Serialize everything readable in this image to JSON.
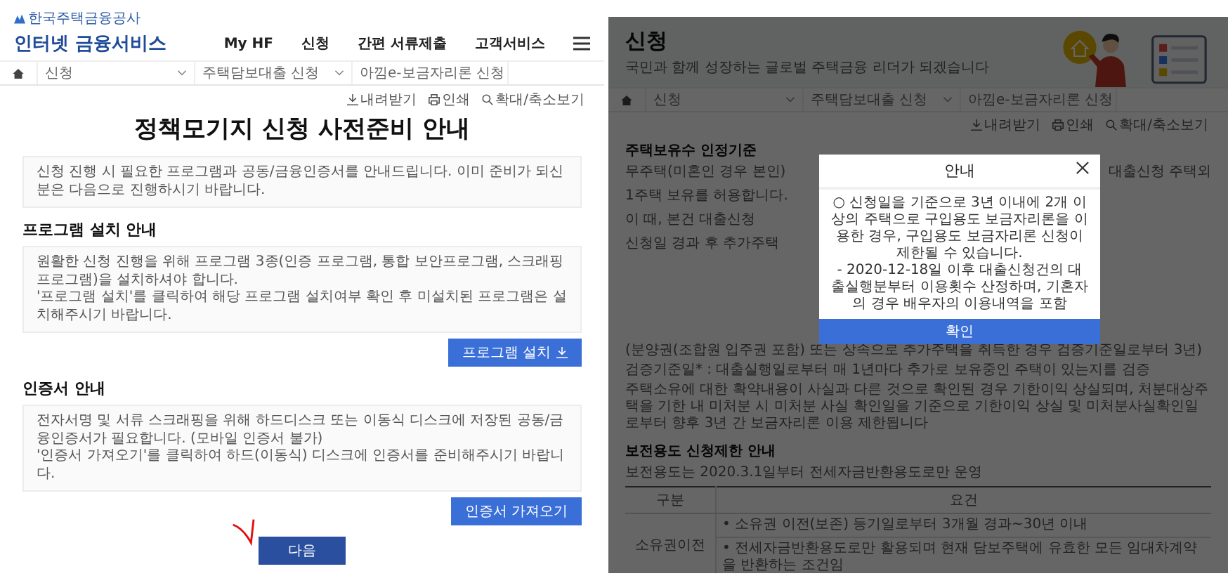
{
  "left_page": {
    "header": {
      "org_name": "한국주택금융공사",
      "service_name": "인터넷 금융서비스",
      "nav": [
        "My HF",
        "신청",
        "간편 서류제출",
        "고객서비스"
      ]
    },
    "breadcrumb": [
      "신청",
      "주택담보대출 신청",
      "아낌e-보금자리론 신청"
    ],
    "tools": [
      "내려받기",
      "인쇄",
      "확대/축소보기"
    ],
    "title": "정책모기지 신청 사전준비 안내",
    "intro": "신청 진행 시 필요한 프로그램과 공동/금융인증서를 안내드립니다. 이미 준비가 되신 분은 다음으로 진행하시기 바랍니다.",
    "sections": [
      {
        "heading": "프로그램 설치 안내",
        "lines": [
          "원활한 신청 진행을 위해 프로그램 3종(인증 프로그램, 통합 보안프로그램, 스크래핑 프로그램)을 설치하셔야 합니다.",
          "'프로그램 설치'를 클릭하여 해당 프로그램 설치여부 확인 후 미설치된 프로그램은 설치해주시기 바랍니다."
        ],
        "button": "프로그램 설치"
      },
      {
        "heading": "인증서 안내",
        "lines": [
          "전자서명 및 서류 스크래핑을 위해 하드디스크 또는 이동식 디스크에 저장된 공동/금융인증서가 필요합니다. (모바일 인증서 불가)",
          "'인증서 가져오기'를 클릭하여 하드(이동식) 디스크에 인증서를 준비해주시기 바랍니다."
        ],
        "button": "인증서 가져오기"
      }
    ],
    "next_button": "다음"
  },
  "right_page": {
    "banner": {
      "title": "신청",
      "subtitle": "국민과 함께 성장하는 글로벌 주택금융 리더가 되겠습니다"
    },
    "breadcrumb": [
      "신청",
      "주택담보대출 신청",
      "아낌e-보금자리론 신청"
    ],
    "tools": [
      "내려받기",
      "인쇄",
      "확대/축소보기"
    ],
    "criteria": {
      "heading": "주택보유수 인정기준",
      "partial_lines": [
        {
          "left": "무주택(미혼인 경우 본인)",
          "right": "대출신청 주택외"
        },
        {
          "left": "1주택 보유를 허용합니다."
        },
        {
          "left": "이 때, 본건 대출신청"
        },
        {
          "left": "신청일 경과 후 추가주택"
        }
      ],
      "lines": [
        "(분양권(조합원 입주권 포함) 또는 상속으로 추가주택을 취득한 경우 검증기준일로부터 3년)",
        "검증기준일* : 대출실행일로부터 매 1년마다 추가로 보유중인 주택이 있는지를 검증",
        "주택소유에 대한 확약내용이 사실과 다른 것으로 확인된 경우 기한이익 상실되며, 처분대상주택을 기한 내 미처분 시 미처분 사실 확인일을 기준으로 기한이익 상실 및 미처분사실확인일로부터 향후 3년 간 보금자리론 이용 제한됩니다"
      ]
    },
    "restriction": {
      "heading": "보전용도 신청제한 안내",
      "note": "보전용도는 2020.3.1일부터 전세자금반환용도로만 운영",
      "table": {
        "columns": [
          "구분",
          "요건"
        ],
        "rows": [
          {
            "category": "소유권이전",
            "requirements": [
              "• 소유권 이전(보존) 등기일로부터 3개월 경과~30년 이내",
              "• 전세자금반환용도로만 활용되며 현재 담보주택에 유효한 모든 임대차계약을 반환하는 조건임"
            ]
          }
        ]
      }
    },
    "modal": {
      "title": "안내",
      "body": [
        "○ 신청일을 기준으로 3년 이내에 2개 이상의 주택으로 구입용도 보금자리론을 이용한 경우, 구입용도 보금자리론 신청이 제한될 수 있습니다.",
        "- 2020-12-18일 이후 대출신청건의 대출실행분부터 이용횟수 산정하며, 기혼자의 경우 배우자의 이용내역을 포함"
      ],
      "confirm": "확인"
    }
  }
}
